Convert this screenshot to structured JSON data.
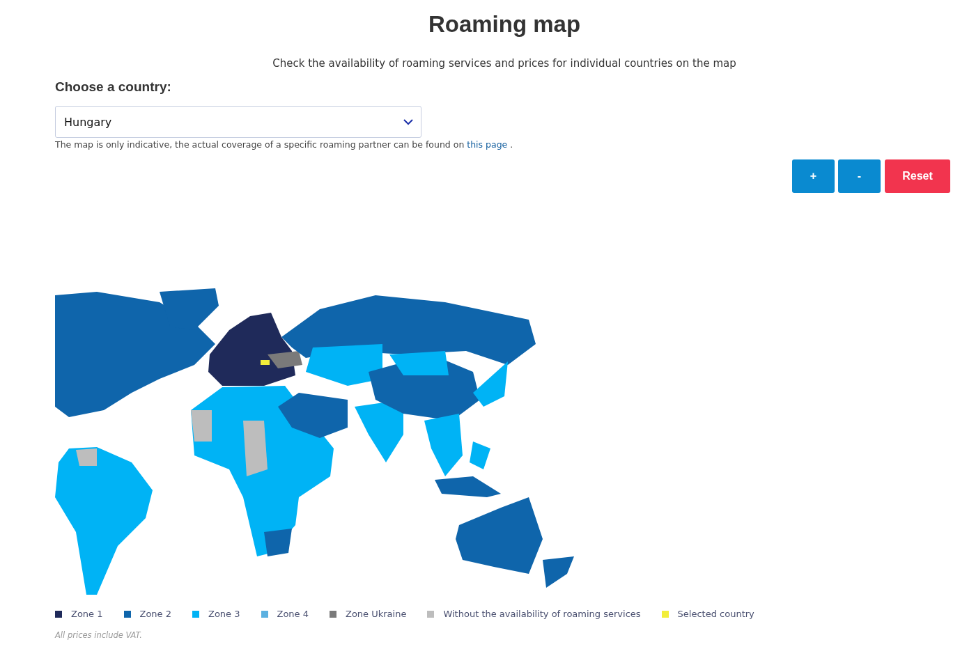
{
  "title": "Roaming map",
  "subtitle": "Check the availability of roaming services and prices for individual countries on the map",
  "country_label": "Choose a country:",
  "country_select": {
    "value": "Hungary"
  },
  "note": {
    "before": "The map is only indicative, the actual coverage of a specific roaming partner can be found on ",
    "link": "this page",
    "after": " ."
  },
  "zoom_buttons": [
    {
      "label": "+",
      "kind": "zoom"
    },
    {
      "label": "-",
      "kind": "zoom"
    },
    {
      "label": "Reset",
      "kind": "reset"
    }
  ],
  "legend": [
    {
      "label": "Zone 1",
      "color": "#1f2a5a"
    },
    {
      "label": "Zone 2",
      "color": "#0f65ab"
    },
    {
      "label": "Zone 3",
      "color": "#00b3f5"
    },
    {
      "label": "Zone 4",
      "color": "#5bb0e0"
    },
    {
      "label": "Zone Ukraine",
      "color": "#7a7a7a"
    },
    {
      "label": "Without the availability of roaming services",
      "color": "#bdbdbd"
    },
    {
      "label": "Selected country",
      "color": "#f2ee3a"
    }
  ],
  "footnote": "All prices include VAT."
}
